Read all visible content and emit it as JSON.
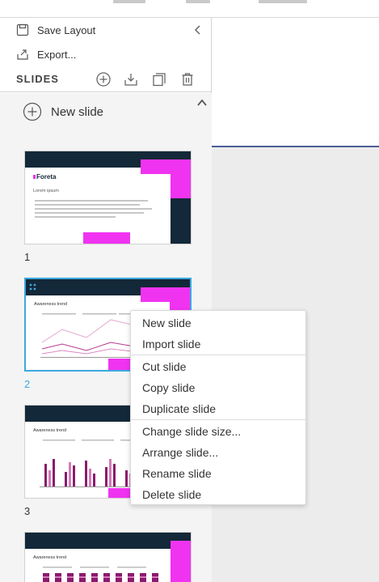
{
  "toolbar": {
    "save_layout": "Save Layout",
    "export": "Export..."
  },
  "slides_panel": {
    "title": "SLIDES",
    "new_slide_label": "New slide"
  },
  "thumbnails": [
    {
      "number": "1",
      "logo": "Foreta",
      "heading": "Lorem ipsum"
    },
    {
      "number": "2",
      "heading": "Awareness trend"
    },
    {
      "number": "3",
      "heading": "Awareness trend"
    },
    {
      "number": "",
      "heading": "Awareness trend"
    }
  ],
  "context_menu": {
    "items": [
      "New slide",
      "Import slide",
      "Cut slide",
      "Copy slide",
      "Duplicate slide",
      "Change slide size...",
      "Arrange slide...",
      "Rename slide",
      "Delete slide"
    ]
  },
  "colors": {
    "navy": "#132838",
    "magenta": "#f033f0",
    "selection": "#3ca7e0",
    "bar_dark": "#8a1a6e",
    "bar_light": "#d57ab8"
  }
}
